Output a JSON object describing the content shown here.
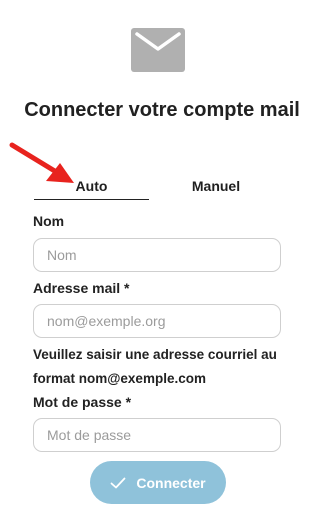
{
  "header": {
    "icon": "mail-icon",
    "title": "Connecter votre compte mail"
  },
  "annotation": {
    "icon": "red-arrow-icon",
    "color": "#e8231e"
  },
  "tabs": [
    {
      "label": "Auto",
      "active": true
    },
    {
      "label": "Manuel",
      "active": false
    }
  ],
  "form": {
    "name_label": "Nom",
    "name_placeholder": "Nom",
    "email_label": "Adresse mail *",
    "email_placeholder": "nom@exemple.org",
    "email_help": "Veuillez saisir une adresse courriel au format nom@exemple.com",
    "password_label": "Mot de passe *",
    "password_placeholder": "Mot de passe",
    "submit_label": "Connecter",
    "submit_icon": "check-icon",
    "submit_color": "#8fc2da"
  }
}
